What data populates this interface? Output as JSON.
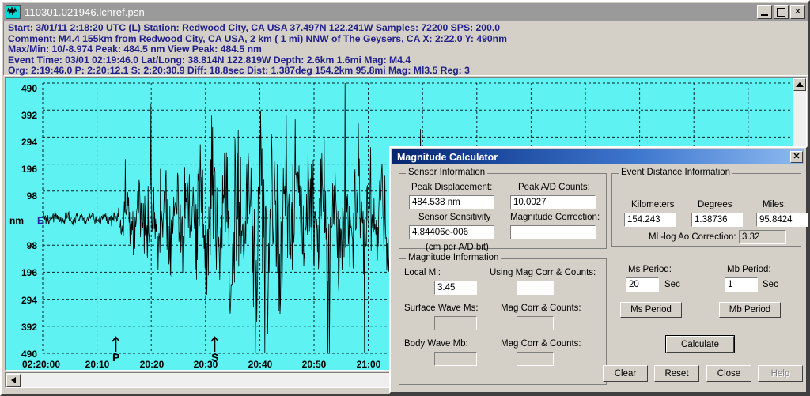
{
  "window": {
    "title": "110301.021946.lchref.psn",
    "icon": "waveform-icon",
    "minimize_label": "_",
    "maximize_label": "□",
    "close_label": "✕"
  },
  "info": {
    "lines": [
      "Start: 3/01/11  2:18:20 UTC (L) Station: Redwood City, CA USA 37.497N 122.241W Samples: 72200  SPS: 200.0",
      "Comment: M4.4 155km from Redwood City, CA USA,   2 km (  1 mi) NNW of The Geysers, CA    X: 2:22.0 Y: 490nm",
      "Max/Min:   10/-8.974  Peak: 484.5 nm  View Peak:  484.5 nm",
      "Event Time: 03/01 02:19:46.0 Lat/Long: 38.814N 122.819W Depth: 2.6km 1.6mi Mag: M4.4",
      "Org: 2:19:46.0 P: 2:20:12.1 S: 2:20:30.9 Diff: 18.8sec Dist: 1.387deg 154.2km 95.8mi  Mag: Ml3.5 Reg: 3"
    ],
    "text_color": "#22228c"
  },
  "chart_data": {
    "type": "line",
    "title": "",
    "xlabel": "",
    "ylabel": "nm",
    "component": "E",
    "background_color": "#5ff2f2",
    "trace_color": "#000000",
    "grid": true,
    "ylim": [
      -490,
      490
    ],
    "y_ticks": [
      490,
      392,
      294,
      196,
      98,
      0,
      98,
      196,
      294,
      392,
      490
    ],
    "y_tick_labels": [
      "490",
      "392",
      "294",
      "196",
      "98",
      "",
      "98",
      "196",
      "294",
      "392",
      "490"
    ],
    "x_tick_labels": [
      "02:20:00",
      "20:10",
      "20:20",
      "20:30",
      "20:40",
      "20:50",
      "21:00"
    ],
    "annotations": [
      {
        "label": "P",
        "x_time": "2:20:12.1"
      },
      {
        "label": "S",
        "x_time": "2:20:30.9"
      }
    ],
    "peak_nm": 484.5,
    "sps": 200.0,
    "samples": 72200
  },
  "scrollbars": {
    "vertical_up_arrow": "▲",
    "horizontal_left_arrow": "◀"
  },
  "dialog": {
    "title": "Magnitude Calculator",
    "close_label": "✕",
    "sensor_information": {
      "legend": "Sensor Information",
      "peak_displacement_label": "Peak Displacement:",
      "peak_displacement_value": "484.538 nm",
      "peak_ad_counts_label": "Peak A/D Counts:",
      "peak_ad_counts_value": "10.0027",
      "sensor_sensitivity_label": "Sensor Sensitivity",
      "sensor_sensitivity_value": "4.84406e-006",
      "sensor_sensitivity_units": "(cm per A/D bit)",
      "magnitude_correction_label": "Magnitude Correction:",
      "magnitude_correction_value": ""
    },
    "event_distance_information": {
      "legend": "Event Distance Information",
      "kilometers_label": "Kilometers",
      "kilometers_value": "154.243",
      "degrees_label": "Degrees",
      "degrees_value": "1.38736",
      "miles_label": "Miles:",
      "miles_value": "95.8424",
      "log_ao_label": "Ml -log Ao Correction:",
      "log_ao_value": "3.32"
    },
    "magnitude_information": {
      "legend": "Magnitude Information",
      "local_ml_label": "Local Ml:",
      "local_ml_value": "3.45",
      "using_mag_corr_label": "Using Mag Corr & Counts:",
      "using_mag_corr_value": "",
      "surface_wave_ms_label": "Surface Wave Ms:",
      "surface_wave_ms_value": "",
      "mag_corr_counts_ms_label": "Mag Corr & Counts:",
      "mag_corr_counts_ms_value": "",
      "body_wave_mb_label": "Body Wave Mb:",
      "body_wave_mb_value": "",
      "mag_corr_counts_mb_label": "Mag Corr & Counts:",
      "mag_corr_counts_mb_value": ""
    },
    "periods": {
      "ms_period_label": "Ms Period:",
      "ms_period_value": "20",
      "ms_period_units": "Sec",
      "ms_period_button": "Ms Period",
      "mb_period_label": "Mb Period:",
      "mb_period_value": "1",
      "mb_period_units": "Sec",
      "mb_period_button": "Mb Period"
    },
    "buttons": {
      "calculate": "Calculate",
      "clear": "Clear",
      "reset": "Reset",
      "close": "Close",
      "help": "Help"
    }
  }
}
